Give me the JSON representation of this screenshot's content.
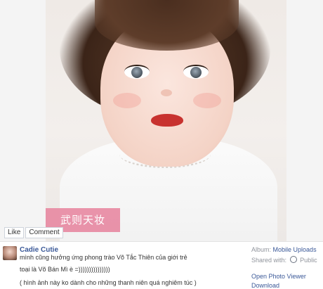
{
  "photo": {
    "watermark_text": "武则天妆"
  },
  "actions": {
    "like_label": "Like",
    "comment_label": "Comment"
  },
  "post": {
    "author": "Cadie Cutie",
    "lines": [
      "mình cũng hưởng ứng phong trào Võ Tắc Thiên của giới trẻ",
      "toại là Võ Bán Mì è =)))))))))))))))",
      "( hình ảnh này ko dành cho những thanh niên quá nghiêm túc )"
    ]
  },
  "meta": {
    "album_label": "Album:",
    "album_value": "Mobile Uploads",
    "shared_label": "Shared with:",
    "shared_value": "Public",
    "shared_icon": "globe-icon",
    "links": [
      "Open Photo Viewer",
      "Download"
    ]
  },
  "colors": {
    "link": "#3b5998",
    "watermark_bg": "#e78aa3",
    "lips": "#c8322f"
  }
}
